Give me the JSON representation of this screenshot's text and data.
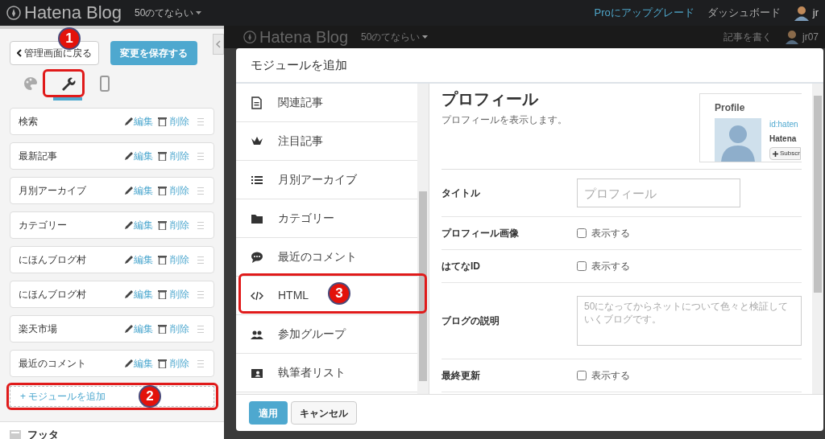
{
  "top_bar": {
    "logo": "Hatena Blog",
    "blog_name": "50のてならい",
    "links": [
      {
        "kind": "upgrade",
        "highlight": "Pro",
        "text": "にアップグレード"
      },
      {
        "kind": "plain",
        "text": "ダッシュボード"
      }
    ],
    "user": "jr"
  },
  "sidebar": {
    "back_button": "管理画面に戻る",
    "save_button": "変更を保存する",
    "tabs": [
      {
        "kind": "design",
        "selected": false
      },
      {
        "kind": "customize",
        "selected": true
      },
      {
        "kind": "smartphone",
        "selected": false
      }
    ],
    "modules": [
      {
        "name": "検索",
        "edit": "編集",
        "delete": "削除"
      },
      {
        "name": "最新記事",
        "edit": "編集",
        "delete": "削除"
      },
      {
        "name": "月別アーカイブ",
        "edit": "編集",
        "delete": "削除"
      },
      {
        "name": "カテゴリー",
        "edit": "編集",
        "delete": "削除"
      },
      {
        "name": "にほんブログ村",
        "edit": "編集",
        "delete": "削除"
      },
      {
        "name": "にほんブログ村",
        "edit": "編集",
        "delete": "削除"
      },
      {
        "name": "楽天市場",
        "edit": "編集",
        "delete": "削除"
      },
      {
        "name": "最近のコメント",
        "edit": "編集",
        "delete": "削除"
      }
    ],
    "add_module": "+ モジュールを追加",
    "next_section": "フッタ"
  },
  "background_header": {
    "logo": "Hatena Blog",
    "blog_name": "50のてならい",
    "write_link": "記事を書く",
    "user": "jr07"
  },
  "dialog": {
    "title": "モジュールを追加",
    "modules": [
      {
        "kind": "related",
        "label": "関連記事"
      },
      {
        "kind": "featured",
        "label": "注目記事"
      },
      {
        "kind": "archive",
        "label": "月別アーカイブ"
      },
      {
        "kind": "category",
        "label": "カテゴリー"
      },
      {
        "kind": "comments",
        "label": "最近のコメント"
      },
      {
        "kind": "html",
        "label": "HTML"
      },
      {
        "kind": "group",
        "label": "参加グループ"
      },
      {
        "kind": "authors",
        "label": "執筆者リスト"
      }
    ],
    "detail": {
      "title": "プロフィール",
      "description": "プロフィールを表示します。",
      "preview": {
        "heading": "Profile",
        "id": "id:haten",
        "name": "Hatena",
        "subscribe": "Subscr"
      },
      "fields": [
        {
          "kind": "text",
          "label": "タイトル",
          "placeholder": "プロフィール"
        },
        {
          "kind": "checkbox",
          "label": "プロフィール画像",
          "option": "表示する",
          "checked": false
        },
        {
          "kind": "checkbox",
          "label": "はてなID",
          "option": "表示する",
          "checked": false
        },
        {
          "kind": "textarea",
          "label": "ブログの説明",
          "placeholder": "50になってからネットについて色々と検証していくブログです。"
        },
        {
          "kind": "checkbox",
          "label": "最終更新",
          "option": "表示する",
          "checked": false
        }
      ]
    },
    "apply_button": "適用",
    "cancel_button": "キャンセル"
  },
  "annotations": [
    {
      "kind": "tab",
      "label": "1"
    },
    {
      "kind": "add_module",
      "label": "2"
    },
    {
      "kind": "dialog_item",
      "label": "3"
    }
  ]
}
